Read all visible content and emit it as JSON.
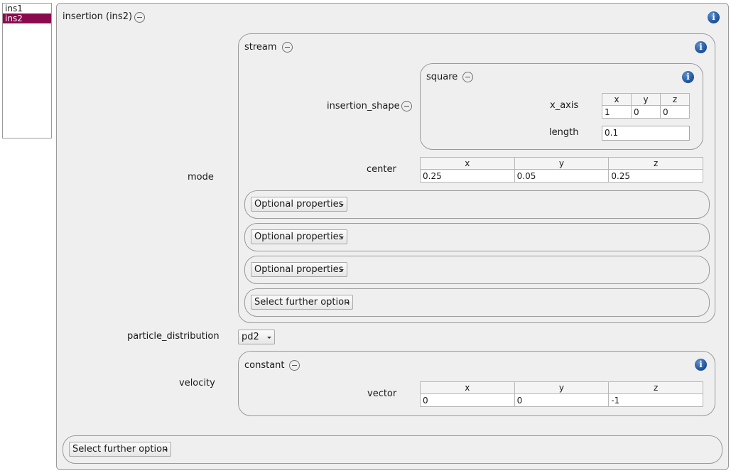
{
  "list": {
    "items": [
      "ins1",
      "ins2"
    ]
  },
  "insertion": {
    "title": "insertion (ins2)",
    "info": "i"
  },
  "labels": {
    "mode": "mode",
    "particle_distribution": "particle_distribution",
    "velocity": "velocity"
  },
  "stream": {
    "title": "stream",
    "info": "i",
    "insertion_shape_label": "insertion_shape",
    "center_label": "center",
    "center_headers": [
      "x",
      "y",
      "z"
    ],
    "center_values": [
      "0.25",
      "0.05",
      "0.25"
    ],
    "optional_buttons": [
      "Optional properties",
      "Optional properties",
      "Optional properties"
    ],
    "further_option": "Select further option"
  },
  "square": {
    "title": "square",
    "info": "i",
    "x_axis_label": "x_axis",
    "x_axis_headers": [
      "x",
      "y",
      "z"
    ],
    "x_axis_values": [
      "1",
      "0",
      "0"
    ],
    "length_label": "length",
    "length_value": "0.1"
  },
  "particle_distribution": {
    "value": "pd2"
  },
  "constant": {
    "title": "constant",
    "info": "i",
    "vector_label": "vector",
    "vector_headers": [
      "x",
      "y",
      "z"
    ],
    "vector_values": [
      "0",
      "0",
      "-1"
    ]
  },
  "footer": {
    "further_option": "Select further option"
  }
}
